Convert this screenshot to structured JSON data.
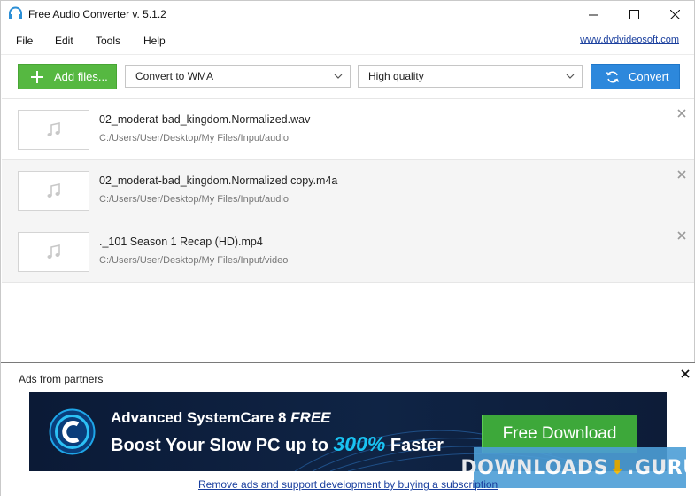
{
  "window": {
    "title": "Free Audio Converter v. 5.1.2",
    "app_icon": "headphones-icon"
  },
  "menu": {
    "items": [
      "File",
      "Edit",
      "Tools",
      "Help"
    ],
    "site_link": "www.dvdvideosoft.com"
  },
  "toolbar": {
    "add_files_label": "Add files...",
    "format_selected": "Convert to WMA",
    "quality_selected": "High quality",
    "convert_label": "Convert",
    "colors": {
      "add_button": "#56b841",
      "convert_button": "#2d88dc"
    }
  },
  "files": [
    {
      "name": "02_moderat-bad_kingdom.Normalized.wav",
      "path": "C:/Users/User/Desktop/My Files/Input/audio",
      "icon": "music-note-icon"
    },
    {
      "name": "02_moderat-bad_kingdom.Normalized copy.m4a",
      "path": "C:/Users/User/Desktop/My Files/Input/audio",
      "icon": "music-note-icon"
    },
    {
      "name": "._101 Season 1 Recap (HD).mp4",
      "path": "C:/Users/User/Desktop/My Files/Input/video",
      "icon": "music-note-icon"
    }
  ],
  "ads": {
    "title": "Ads from partners",
    "banner": {
      "product": "Advanced SystemCare 8",
      "free_tag": "FREE",
      "line2_prefix": "Boost Your Slow PC up to",
      "line2_percent": "300%",
      "line2_suffix": "Faster",
      "cta": "Free Download"
    },
    "watermark_left": "DOWNLOADS",
    "watermark_right": "GURU",
    "remove_link": "Remove ads and support development by buying a subscription"
  }
}
